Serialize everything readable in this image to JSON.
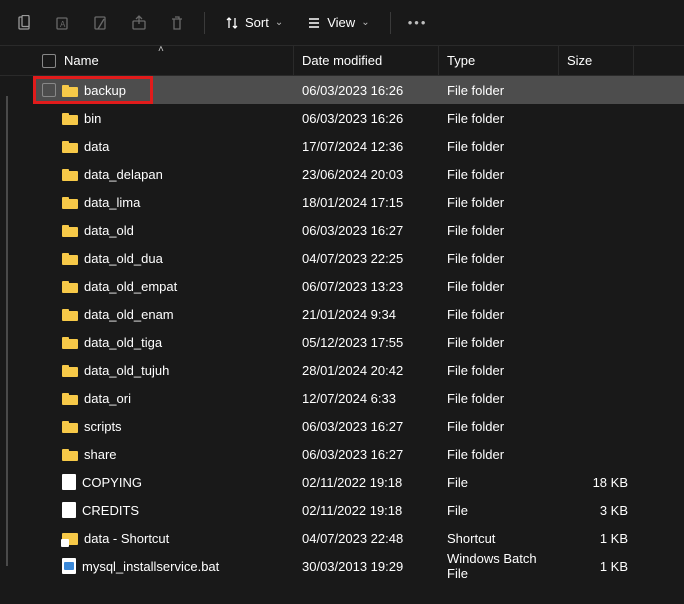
{
  "toolbar": {
    "sort_label": "Sort",
    "view_label": "View"
  },
  "columns": {
    "name": "Name",
    "date": "Date modified",
    "type": "Type",
    "size": "Size"
  },
  "items": [
    {
      "name": "backup",
      "date": "06/03/2023 16:26",
      "type": "File folder",
      "size": "",
      "icon": "folder",
      "selected": true,
      "highlighted": true
    },
    {
      "name": "bin",
      "date": "06/03/2023 16:26",
      "type": "File folder",
      "size": "",
      "icon": "folder"
    },
    {
      "name": "data",
      "date": "17/07/2024 12:36",
      "type": "File folder",
      "size": "",
      "icon": "folder"
    },
    {
      "name": "data_delapan",
      "date": "23/06/2024 20:03",
      "type": "File folder",
      "size": "",
      "icon": "folder"
    },
    {
      "name": "data_lima",
      "date": "18/01/2024 17:15",
      "type": "File folder",
      "size": "",
      "icon": "folder"
    },
    {
      "name": "data_old",
      "date": "06/03/2023 16:27",
      "type": "File folder",
      "size": "",
      "icon": "folder"
    },
    {
      "name": "data_old_dua",
      "date": "04/07/2023 22:25",
      "type": "File folder",
      "size": "",
      "icon": "folder"
    },
    {
      "name": "data_old_empat",
      "date": "06/07/2023 13:23",
      "type": "File folder",
      "size": "",
      "icon": "folder"
    },
    {
      "name": "data_old_enam",
      "date": "21/01/2024 9:34",
      "type": "File folder",
      "size": "",
      "icon": "folder"
    },
    {
      "name": "data_old_tiga",
      "date": "05/12/2023 17:55",
      "type": "File folder",
      "size": "",
      "icon": "folder"
    },
    {
      "name": "data_old_tujuh",
      "date": "28/01/2024 20:42",
      "type": "File folder",
      "size": "",
      "icon": "folder"
    },
    {
      "name": "data_ori",
      "date": "12/07/2024 6:33",
      "type": "File folder",
      "size": "",
      "icon": "folder"
    },
    {
      "name": "scripts",
      "date": "06/03/2023 16:27",
      "type": "File folder",
      "size": "",
      "icon": "folder"
    },
    {
      "name": "share",
      "date": "06/03/2023 16:27",
      "type": "File folder",
      "size": "",
      "icon": "folder"
    },
    {
      "name": "COPYING",
      "date": "02/11/2022 19:18",
      "type": "File",
      "size": "18 KB",
      "icon": "file"
    },
    {
      "name": "CREDITS",
      "date": "02/11/2022 19:18",
      "type": "File",
      "size": "3 KB",
      "icon": "file"
    },
    {
      "name": "data - Shortcut",
      "date": "04/07/2023 22:48",
      "type": "Shortcut",
      "size": "1 KB",
      "icon": "shortcut"
    },
    {
      "name": "mysql_installservice.bat",
      "date": "30/03/2013 19:29",
      "type": "Windows Batch File",
      "size": "1 KB",
      "icon": "bat"
    }
  ]
}
